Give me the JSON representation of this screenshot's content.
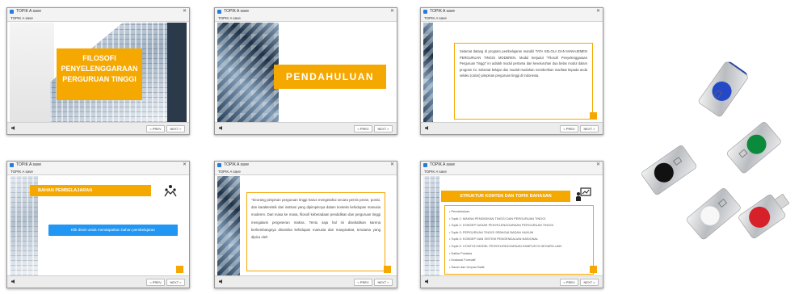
{
  "window": {
    "title": "TOPIK A save",
    "menu": "TOPIK A save",
    "prev_label": "< PREV",
    "next_label": "NEXT >"
  },
  "slides": [
    {
      "title": "FILOSOFI PENYELENGGARAAN PERGURUAN TINGGI"
    },
    {
      "title": "PENDAHULUAN"
    },
    {
      "body": "Selamat datang di program pembelajaran mandiri TATA KELOLA DAN MANAJEMEN PERGURUAN TINGGI MODEREN. Modul berjudul \"Filosofi Penyelenggaraan Perguruan Tinggi\" ini adalah modul pertama dari keseluruhan dua belas modul dalam program ini. Selamat belajar dan mudah-mudahan memberikan manfaat kepada anda selaku (calon) pimpinan perguruan tinggi di Indonesia."
    },
    {
      "title": "BAHAN PEMBELAJARAN",
      "button": "Klik disini untuk mendapatkan bahan pembelajaran"
    },
    {
      "body": "\"Seorang pimpinan perguruan tinggi harus mengetahui secara persis peran, posisi, dan karakteristik dari institusi yang dipimpinnya dalam konteks kehidupan manusia moderen. Dari masa ke masa, filosofi keberadaan pendidikan dan perguruan tinggi mengalami pergeseran makna. Tentu saja hal ini disebabkan karena berkembangnya dinamika kehidupan manusia dan masyarakat, terutama yang dipicu oleh"
    },
    {
      "title": "STRUKTUR KONTEN DAN TOPIK BAHASAN",
      "items": [
        "Pendahuluan",
        "Topik 1: MAKNA PENDIDIKAN TINGGI DAN PERGURUAN TINGGI",
        "Topik 2: KONSEP DASAR PENYELENGGARAAN PERGURUAN TINGGI",
        "Topik 3: PERGURUAN TINGGI SEBAGAI BADAN HUKUM",
        "Topik 4: KONSEP DAN SISTEM PENGENDALIAN NASIONAL",
        "Topik 5: CONTOH MODEL PENYELENGGARAAN KAMPUS DI NEGARA LAIN",
        "Daftar Pustaka",
        "Evaluasi Formatif",
        "Saran dan Umpan Balik"
      ]
    }
  ],
  "colors": {
    "accent": "#f5a800",
    "button_blue": "#2196f3"
  },
  "usb_drives": [
    {
      "color": "blue"
    },
    {
      "color": "black"
    },
    {
      "color": "green"
    },
    {
      "color": "white"
    },
    {
      "color": "red"
    }
  ]
}
